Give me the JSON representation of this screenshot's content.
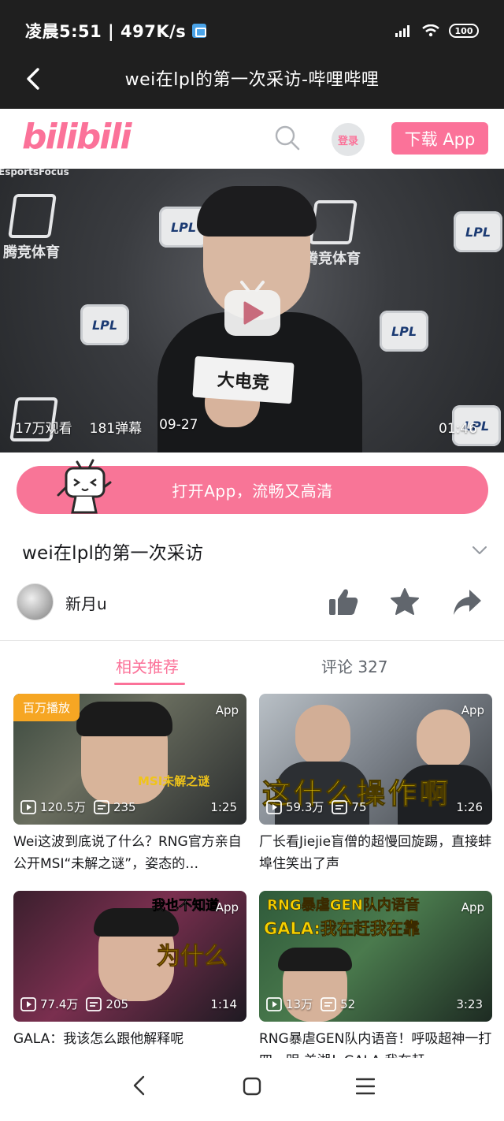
{
  "status_bar": {
    "time": "凌晨5:51 | 497K/s",
    "battery": "100"
  },
  "title_bar": {
    "title": "wei在lpl的第一次采访-哔哩哔哩"
  },
  "header": {
    "logo": "bilibili",
    "login_label": "登录",
    "download_label": "下载 App"
  },
  "player": {
    "views": "17万观看",
    "danmaku": "181弹幕",
    "date": "09-27",
    "duration": "01:46",
    "watermark_logo": "EsportsFocus",
    "card_text": "大电竞",
    "sponsor_text": "腾竞体育",
    "lpl_text": "LPL"
  },
  "open_app": {
    "label": "打开App，流畅又高清"
  },
  "video": {
    "title": "wei在lpl的第一次采访",
    "author": "新月u"
  },
  "tabs": {
    "recommend": "相关推荐",
    "comments": "评论 327"
  },
  "cards": [
    {
      "tag": "百万播放",
      "app": "App",
      "views": "120.5万",
      "danmaku": "235",
      "duration": "1:25",
      "caption": "MSI未解之谜",
      "title": "Wei这波到底说了什么？RNG官方亲自公开MSI“未解之谜”，姿态的…"
    },
    {
      "app": "App",
      "views": "59.3万",
      "danmaku": "75",
      "duration": "1:26",
      "caption": "这什么操作啊",
      "title": "厂长看Jiejie盲僧的超慢回旋踢，直接蚌埠住笑出了声"
    },
    {
      "app": "App",
      "views": "77.4万",
      "danmaku": "205",
      "duration": "1:14",
      "caption": "为什么",
      "caption_top": "我也不知道",
      "title": "GALA：我该怎么跟他解释呢"
    },
    {
      "app": "App",
      "views": "13万",
      "danmaku": "52",
      "duration": "3:23",
      "caption": "RNG暴虐GEN队内语音",
      "caption_sub": "GALA:我在赶我在靠",
      "title": "RNG暴虐GEN队内语音！呼吸超神一打四，明:羌湖！GALA:我在赶…"
    }
  ],
  "colors": {
    "brand_pink": "#fb7299",
    "million_orange": "#f6a623"
  }
}
